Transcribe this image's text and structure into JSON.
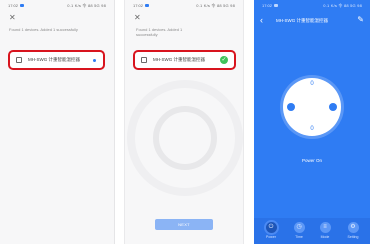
{
  "status_bar": {
    "time": "17:02",
    "icons": "0.1 K/s 令 88 5G 98"
  },
  "screen1": {
    "close_icon": "close-icon",
    "found_text": "Found 1 devices. Added 1 successfully",
    "device": {
      "name": "MH-SWG 计重智能温控器",
      "state_icon": "blue-dot"
    }
  },
  "screen2": {
    "close_icon": "close-icon",
    "found_text": "Found 1 devices. Added 1 successfully",
    "device": {
      "name": "MH-SWG 计重智能温控器",
      "state_icon": "check-icon"
    },
    "next_label": "NEXT"
  },
  "screen3": {
    "title": "MH-SWG 计重智能温控器",
    "pad": {
      "top_digit": "0",
      "bottom_digit": "0"
    },
    "power_label": "Power On",
    "tabs": [
      {
        "label": "Power",
        "icon": "power-icon",
        "glyph": "⏻"
      },
      {
        "label": "Time",
        "icon": "clock-icon",
        "glyph": "◷"
      },
      {
        "label": "Mode",
        "icon": "mode-icon",
        "glyph": "≡"
      },
      {
        "label": "Setting",
        "icon": "settings-icon",
        "glyph": "⚙"
      }
    ]
  },
  "colors": {
    "accent": "#2f7cf3",
    "highlight_border": "#d8141e",
    "success": "#3ec25a"
  }
}
